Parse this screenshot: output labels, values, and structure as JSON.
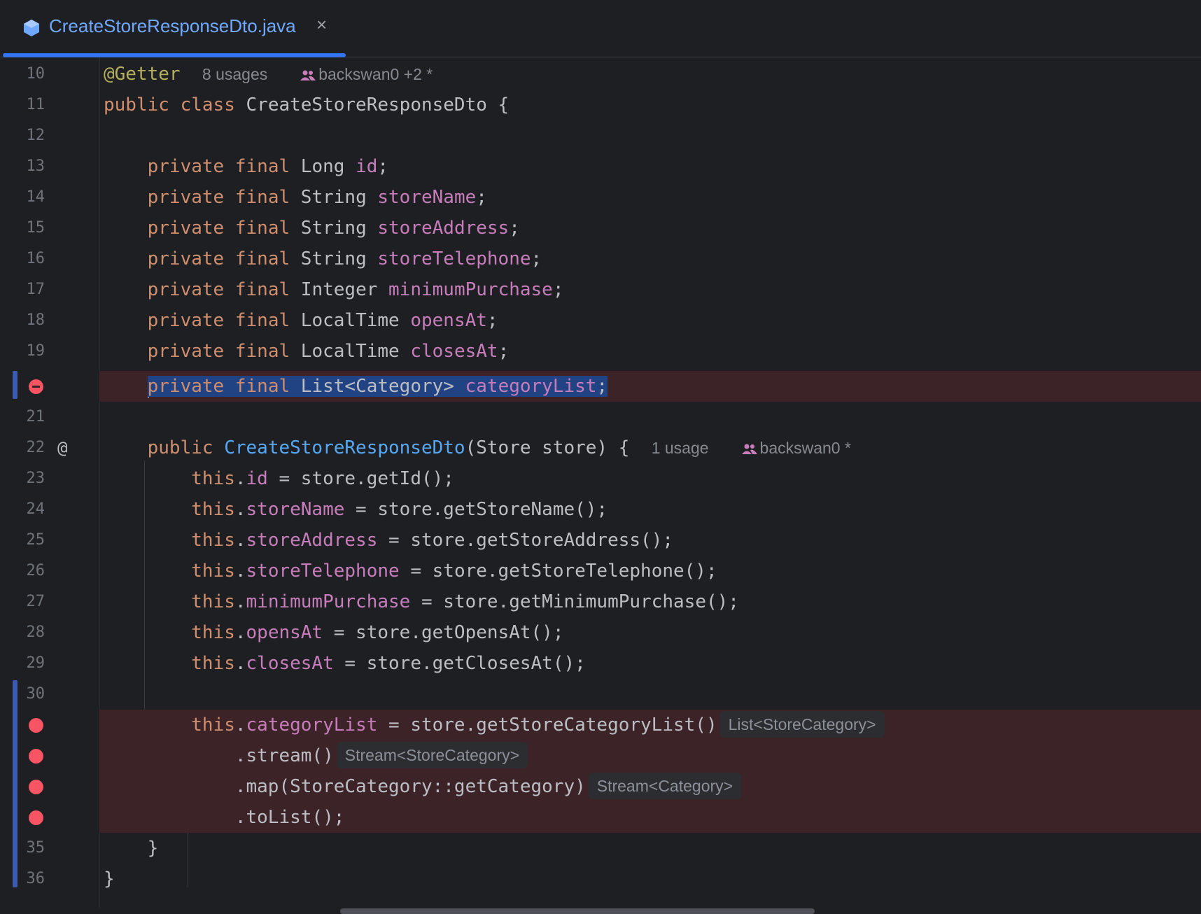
{
  "tab": {
    "file_name": "CreateStoreResponseDto.java",
    "close_glyph": "×",
    "icon": "java-class-icon",
    "accent": "#3574f0"
  },
  "inlay_hints": {
    "class_usages": "8 usages",
    "class_authors": "backswan0 +2 *",
    "ctor_usages": "1 usage",
    "ctor_authors": "backswan0 *"
  },
  "type_hints": [
    "List<StoreCategory>",
    "Stream<StoreCategory>",
    "Stream<Category>"
  ],
  "lines": [
    {
      "num": "10",
      "t": [
        "@Getter"
      ]
    },
    {
      "num": "11",
      "t": [
        "public",
        "class",
        "CreateStoreResponseDto",
        "{"
      ]
    },
    {
      "num": "12",
      "t": []
    },
    {
      "num": "13",
      "t": [
        "private",
        "final",
        "Long",
        "id",
        ";"
      ]
    },
    {
      "num": "14",
      "t": [
        "private",
        "final",
        "String",
        "storeName",
        ";"
      ]
    },
    {
      "num": "15",
      "t": [
        "private",
        "final",
        "String",
        "storeAddress",
        ";"
      ]
    },
    {
      "num": "16",
      "t": [
        "private",
        "final",
        "String",
        "storeTelephone",
        ";"
      ]
    },
    {
      "num": "17",
      "t": [
        "private",
        "final",
        "Integer",
        "minimumPurchase",
        ";"
      ]
    },
    {
      "num": "18",
      "t": [
        "private",
        "final",
        "LocalTime",
        "opensAt",
        ";"
      ]
    },
    {
      "num": "19",
      "t": [
        "private",
        "final",
        "LocalTime",
        "closesAt",
        ";"
      ]
    },
    {
      "num": "",
      "t": [
        "private",
        "final",
        "List<Category>",
        "categoryList",
        ";"
      ]
    },
    {
      "num": "21",
      "t": []
    },
    {
      "num": "22",
      "t": [
        "public",
        "CreateStoreResponseDto",
        "(Store store) {"
      ],
      "marker": "@"
    },
    {
      "num": "23",
      "t": [
        "this",
        ".",
        "id",
        " = store.getId();"
      ]
    },
    {
      "num": "24",
      "t": [
        "this",
        ".",
        "storeName",
        " = store.getStoreName();"
      ]
    },
    {
      "num": "25",
      "t": [
        "this",
        ".",
        "storeAddress",
        " = store.getStoreAddress();"
      ]
    },
    {
      "num": "26",
      "t": [
        "this",
        ".",
        "storeTelephone",
        " = store.getStoreTelephone();"
      ]
    },
    {
      "num": "27",
      "t": [
        "this",
        ".",
        "minimumPurchase",
        " = store.getMinimumPurchase();"
      ]
    },
    {
      "num": "28",
      "t": [
        "this",
        ".",
        "opensAt",
        " = store.getOpensAt();"
      ]
    },
    {
      "num": "29",
      "t": [
        "this",
        ".",
        "closesAt",
        " = store.getClosesAt();"
      ]
    },
    {
      "num": "30",
      "t": []
    },
    {
      "num": "",
      "t": [
        "this",
        ".",
        "categoryList",
        " = store.getStoreCategoryList()"
      ]
    },
    {
      "num": "",
      "t": [
        ".stream()"
      ]
    },
    {
      "num": "",
      "t": [
        ".map(StoreCategory::getCategory)"
      ]
    },
    {
      "num": "",
      "t": [
        ".toList();"
      ]
    },
    {
      "num": "35",
      "t": [
        "}"
      ]
    },
    {
      "num": "36",
      "t": [
        "}"
      ]
    }
  ],
  "colors": {
    "background": "#1e1f22",
    "keyword": "#cf8e6d",
    "annotation": "#b3ae60",
    "field": "#c77dbb",
    "function": "#56a8f5",
    "deleted_line_bg": "#3b2327",
    "breakpoint": "#f75464",
    "selection": "#214283"
  }
}
